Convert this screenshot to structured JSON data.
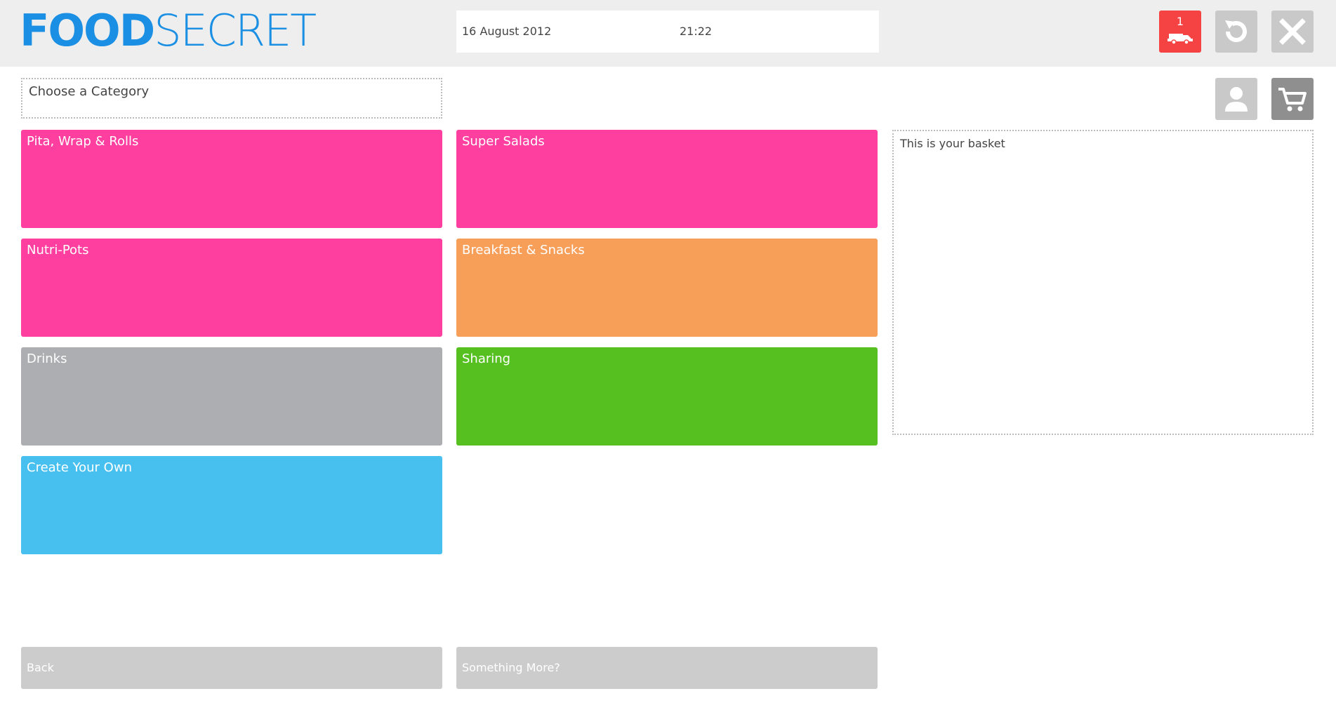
{
  "header": {
    "logo_left": "FOOD",
    "logo_right": "SECRET",
    "date": "16 August 2012",
    "time": "21:22",
    "delivery_count": "1"
  },
  "category_prompt": "Choose a Category",
  "categories": [
    {
      "label": "Pita, Wrap & Rolls",
      "color": "#fe3f9f"
    },
    {
      "label": "Super Salads",
      "color": "#fe3f9f"
    },
    {
      "label": "Nutri-Pots",
      "color": "#fe3f9f"
    },
    {
      "label": "Breakfast & Snacks",
      "color": "#f79e59"
    },
    {
      "label": "Drinks",
      "color": "#adaeb2"
    },
    {
      "label": "Sharing",
      "color": "#56c021"
    },
    {
      "label": "Create Your Own",
      "color": "#47c0ef"
    }
  ],
  "basket": {
    "text": "This is your basket"
  },
  "footer": {
    "back_label": "Back",
    "more_label": "Something More?"
  },
  "icons": {
    "delivery": "delivery-van-icon",
    "refresh": "refresh-icon",
    "close": "close-icon",
    "user": "user-icon",
    "cart": "shopping-cart-icon"
  },
  "colors": {
    "accent": "#1a8fe3",
    "delivery": "#f54242",
    "header_bg": "#eeeeee",
    "button_grey": "#c9c9c9",
    "cart_grey": "#8f8f8f",
    "footer_button": "#cccccc"
  }
}
